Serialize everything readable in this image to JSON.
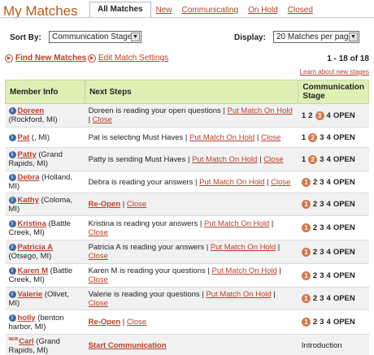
{
  "header": {
    "title": "My Matches",
    "tabs": [
      {
        "label": "All Matches",
        "active": true
      },
      {
        "label": "New"
      },
      {
        "label": "Communicating"
      },
      {
        "label": "On Hold"
      },
      {
        "label": "Closed"
      }
    ]
  },
  "controls": {
    "sort_label": "Sort By:",
    "sort_value": "Communication Stage",
    "display_label": "Display:",
    "display_value": "20 Matches per page"
  },
  "links": {
    "find": "Find New Matches",
    "edit": "Edit Match Settings",
    "range": "1 - 18 of 18",
    "learn": "Learn about new stages"
  },
  "table": {
    "headers": [
      "Member Info",
      "Next Steps",
      "Communication Stage"
    ],
    "rows": [
      {
        "name": "Doreen",
        "loc": " (Rockford, MI)",
        "badge": "info",
        "action": "Doreen is reading your open questions | ",
        "links": [
          "Put Match On Hold",
          "Close"
        ],
        "stage": {
          "numbers": [
            "1",
            "2",
            "3",
            "4",
            "OPEN"
          ],
          "current": 2
        }
      },
      {
        "name": "Pat",
        "loc": " (, MI)",
        "badge": "info",
        "action": "Pat is selecting Must Haves | ",
        "links": [
          "Put Match On Hold",
          "Close"
        ],
        "stage": {
          "numbers": [
            "1",
            "2",
            "3",
            "4",
            "OPEN"
          ],
          "current": 1
        }
      },
      {
        "name": "Patty",
        "loc": " (Grand Rapids, MI)",
        "badge": "info",
        "action": "Patty is sending Must Haves | ",
        "links": [
          "Put Match On Hold",
          "Close"
        ],
        "stage": {
          "numbers": [
            "1",
            "2",
            "3",
            "4",
            "OPEN"
          ],
          "current": 1
        }
      },
      {
        "name": "Debra",
        "loc": " (Holland, MI)",
        "badge": "info",
        "action": "Debra is reading your answers | ",
        "links": [
          "Put Match On Hold",
          "Close"
        ],
        "stage": {
          "numbers": [
            "1",
            "2",
            "3",
            "4",
            "OPEN"
          ],
          "current": 0
        }
      },
      {
        "name": "Kathy",
        "loc": " (Coloma, MI)",
        "badge": "info",
        "action": "",
        "bold_first": true,
        "links": [
          "Re-Open",
          "Close"
        ],
        "stage": {
          "numbers": [
            "1",
            "2",
            "3",
            "4",
            "OPEN"
          ],
          "current": 0
        }
      },
      {
        "name": "Kristina",
        "loc": " (Battle Creek, MI)",
        "badge": "info",
        "action": "Kristina is reading your answers | ",
        "links": [
          "Put Match On Hold",
          "Close"
        ],
        "stage": {
          "numbers": [
            "1",
            "2",
            "3",
            "4",
            "OPEN"
          ],
          "current": 0
        }
      },
      {
        "name": "Patricia A",
        "loc": " (Otsego, MI)",
        "badge": "info",
        "action": "Patricia A is reading your answers | ",
        "links": [
          "Put Match On Hold",
          "Close"
        ],
        "stage": {
          "numbers": [
            "1",
            "2",
            "3",
            "4",
            "OPEN"
          ],
          "current": 0
        }
      },
      {
        "name": "Karen M",
        "loc": " (Battle Creek, MI)",
        "badge": "info",
        "action": "Karen M is reading your questions | ",
        "links": [
          "Put Match On Hold",
          "Close"
        ],
        "stage": {
          "numbers": [
            "1",
            "2",
            "3",
            "4",
            "OPEN"
          ],
          "current": 0
        }
      },
      {
        "name": "Valerie",
        "loc": " (Olivet, MI)",
        "badge": "info",
        "action": "Valerie is reading your questions | ",
        "links": [
          "Put Match On Hold",
          "Close"
        ],
        "stage": {
          "numbers": [
            "1",
            "2",
            "3",
            "4",
            "OPEN"
          ],
          "current": 0
        }
      },
      {
        "name": "holly",
        "loc": " (benton harbor, MI)",
        "badge": "info",
        "action": "",
        "bold_first": true,
        "links": [
          "Re-Open",
          "Close"
        ],
        "stage": {
          "numbers": [
            "1",
            "2",
            "3",
            "4",
            "OPEN"
          ],
          "current": 0
        }
      },
      {
        "name": "Carl",
        "loc": " (Grand Rapids, MI)",
        "badge": "NEW",
        "action": "",
        "bold_first": true,
        "single": true,
        "links": [
          "Start Communication"
        ],
        "stage": {
          "text": "Introduction"
        }
      }
    ]
  },
  "icons": {
    "info": "i",
    "arrow": "▶",
    "select_arrow": "▼"
  },
  "colors": {
    "title": "#c25a17",
    "link": "#b8402a",
    "header_bg": "#dff0b5",
    "stage_current": "#d4794d",
    "info_icon": "#3f6aa6"
  }
}
